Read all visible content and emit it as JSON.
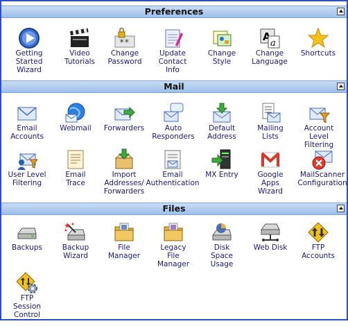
{
  "sections": [
    {
      "title": "Preferences",
      "items": [
        {
          "label": "Getting\nStarted\nWizard",
          "icon": "play-icon"
        },
        {
          "label": "Video\nTutorials",
          "icon": "clapperboard-icon"
        },
        {
          "label": "Change\nPassword",
          "icon": "password-lock-icon"
        },
        {
          "label": "Update\nContact\nInfo",
          "icon": "notepad-pencil-icon"
        },
        {
          "label": "Change\nStyle",
          "icon": "style-palette-icon"
        },
        {
          "label": "Change\nLanguage",
          "icon": "language-aa-icon"
        },
        {
          "label": "Shortcuts",
          "icon": "star-icon"
        }
      ]
    },
    {
      "title": "Mail",
      "items": [
        {
          "label": "Email\nAccounts",
          "icon": "envelope-icon"
        },
        {
          "label": "Webmail",
          "icon": "globe-envelope-icon"
        },
        {
          "label": "Forwarders",
          "icon": "forward-arrow-envelope-icon"
        },
        {
          "label": "Auto\nResponders",
          "icon": "speech-bubble-envelope-icon"
        },
        {
          "label": "Default\nAddress",
          "icon": "download-arrow-envelope-icon"
        },
        {
          "label": "Mailing\nLists",
          "icon": "list-envelope-icon"
        },
        {
          "label": "Account\nLevel\nFiltering",
          "icon": "funnel-envelope-icon"
        },
        {
          "label": "User Level\nFiltering",
          "icon": "user-funnel-envelope-icon"
        },
        {
          "label": "Email\nTrace",
          "icon": "trace-envelope-icon"
        },
        {
          "label": "Import\nAddresses/\nForwarders",
          "icon": "import-box-icon"
        },
        {
          "label": "Email\nAuthentication",
          "icon": "certificate-envelope-icon"
        },
        {
          "label": "MX Entry",
          "icon": "server-arrow-icon"
        },
        {
          "label": "Google\nApps\nWizard",
          "icon": "gmail-logo-icon"
        },
        {
          "label": "MailScanner\nConfiguration",
          "icon": "block-envelope-icon"
        }
      ]
    },
    {
      "title": "Files",
      "items": [
        {
          "label": "Backups",
          "icon": "hard-drive-icon"
        },
        {
          "label": "Backup\nWizard",
          "icon": "sparkle-drive-icon"
        },
        {
          "label": "File\nManager",
          "icon": "folder-icon"
        },
        {
          "label": "Legacy\nFile\nManager",
          "icon": "folder-legacy-icon"
        },
        {
          "label": "Disk\nSpace\nUsage",
          "icon": "disk-chart-icon"
        },
        {
          "label": "Web Disk",
          "icon": "network-disk-icon"
        },
        {
          "label": "FTP\nAccounts",
          "icon": "ftp-arrows-icon"
        },
        {
          "label": "FTP\nSession\nControl",
          "icon": "ftp-gear-icon"
        }
      ]
    }
  ]
}
